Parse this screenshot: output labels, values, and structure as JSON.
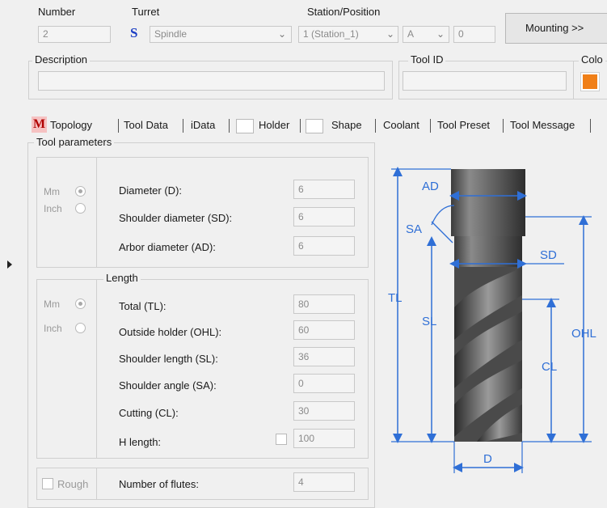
{
  "header": {
    "number_label": "Number",
    "number_value": "2",
    "turret_label": "Turret",
    "turret_icon_letter": "S",
    "turret_value": "Spindle",
    "station_label": "Station/Position",
    "station_value": "1 (Station_1)",
    "position_value": "A",
    "offset_value": "0",
    "mounting_button": "Mounting >>",
    "description_label": "Description",
    "description_value": "",
    "toolid_label": "Tool ID",
    "toolid_value": "",
    "color_label": "Colo",
    "color_value": "#f07f17"
  },
  "tabs": {
    "m_icon": "M",
    "items": [
      "Topology",
      "Tool Data",
      "iData",
      "Holder",
      "Shape",
      "Coolant",
      "Tool Preset",
      "Tool Message"
    ]
  },
  "params": {
    "group_title": "Tool parameters",
    "unit_mm": "Mm",
    "unit_inch": "Inch",
    "diameter_label": "Diameter (D):",
    "diameter_value": "6",
    "sd_label": "Shoulder diameter (SD):",
    "sd_value": "6",
    "ad_label": "Arbor diameter (AD):",
    "ad_value": "6",
    "length_title": "Length",
    "tl_label": "Total (TL):",
    "tl_value": "80",
    "ohl_label": "Outside holder (OHL):",
    "ohl_value": "60",
    "sl_label": "Shoulder length (SL):",
    "sl_value": "36",
    "sa_label": "Shoulder angle (SA):",
    "sa_value": "0",
    "cl_label": "Cutting (CL):",
    "cl_value": "30",
    "h_label": "H length:",
    "h_value": "100",
    "rough_label": "Rough",
    "flutes_label": "Number of flutes:",
    "flutes_value": "4"
  },
  "diagram": {
    "ad": "AD",
    "sa": "SA",
    "sd": "SD",
    "tl": "TL",
    "sl": "SL",
    "ohl": "OHL",
    "cl": "CL",
    "d": "D",
    "dim_color": "#2f6fd6"
  }
}
